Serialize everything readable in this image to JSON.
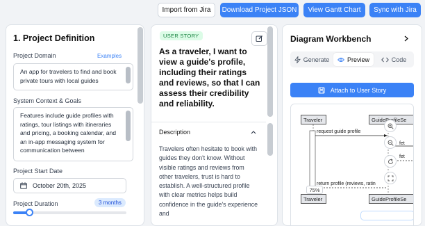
{
  "toolbar": {
    "import_label": "Import from Jira",
    "download_label": "Download Project JSON",
    "gantt_label": "View Gantt Chart",
    "sync_label": "Sync with Jira"
  },
  "project": {
    "title": "1. Project Definition",
    "domain_label": "Project Domain",
    "examples_link": "Examples",
    "domain_value": "An app for travelers to find and book private tours with local guides",
    "context_label": "System Context & Goals",
    "context_value": "Features include guide profiles with ratings, tour listings with itineraries and pricing, a booking calendar, and an in-app messaging system for communication between",
    "start_label": "Project Start Date",
    "start_value": "October 20th, 2025",
    "duration_label": "Project Duration",
    "duration_value": "3 months",
    "duration_fraction": 0.14
  },
  "story": {
    "tag": "USER STORY",
    "text": "As a traveler, I want to view a guide's profile, including their ratings and reviews, so that I can assess their credibility and reliability.",
    "description_label": "Description",
    "description_text": "Travelers often hesitate to book with guides they don't know. Without visible ratings and reviews from other travelers, trust is hard to establish. A well-structured profile with clear metrics helps build confidence in the guide's experience and"
  },
  "workbench": {
    "title": "Diagram Workbench",
    "tabs": [
      "Generate",
      "Preview",
      "Code"
    ],
    "active_tab": "Preview",
    "attach_label": "Attach to User Story",
    "zoom_label": "75%",
    "diagram": {
      "actor_left": "Traveler",
      "actor_right": "GuideProfileSe",
      "msg1": "request guide profile",
      "msg2": "fet",
      "msg3": "fet",
      "msg4": "return profile (reviews, ratin"
    }
  },
  "colors": {
    "accent": "#3b82f6",
    "tag_bg": "#dcfce7",
    "tag_text": "#15803d"
  }
}
